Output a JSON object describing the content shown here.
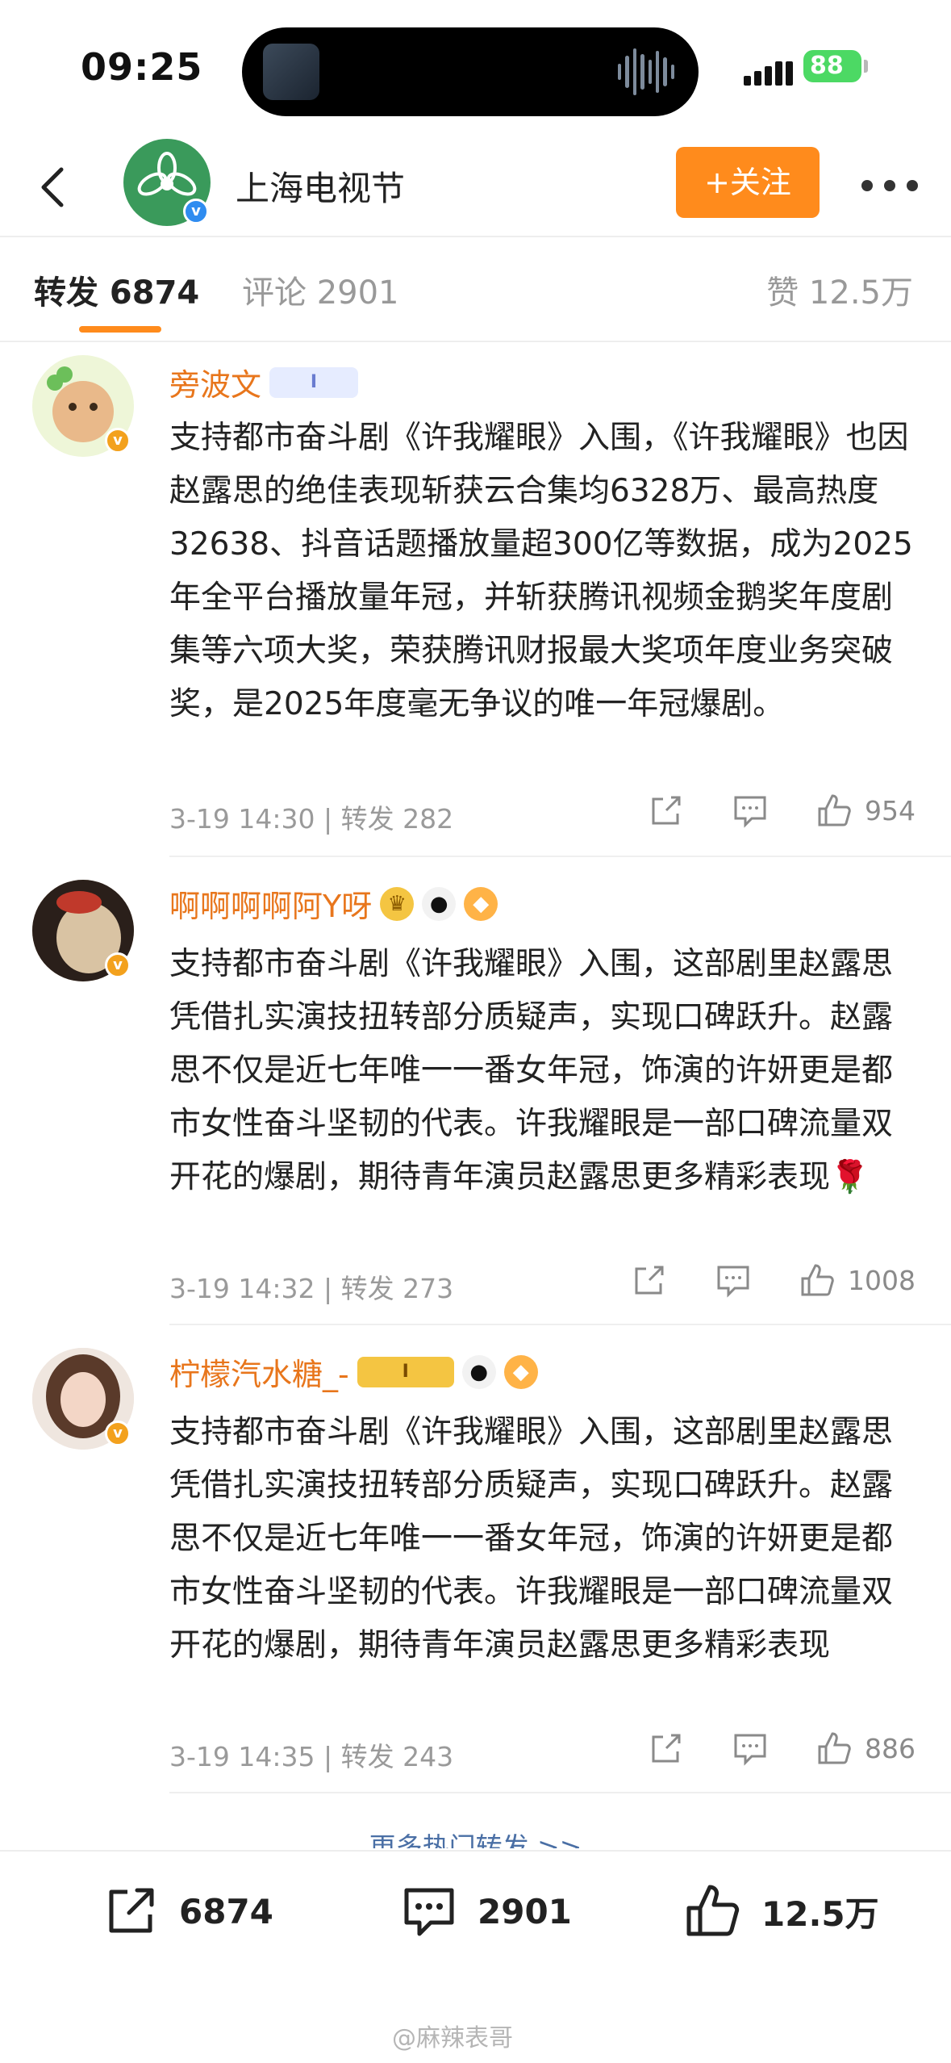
{
  "status_bar": {
    "time": "09:25",
    "battery": "88"
  },
  "header": {
    "account_name": "上海电视节",
    "follow_label": "+关注"
  },
  "tabs": {
    "repost": "转发 6874",
    "comments": "评论 2901",
    "likes": "赞 12.5万"
  },
  "posts": [
    {
      "author": "旁波文",
      "badge": "I",
      "text": "支持都市奋斗剧《许我耀眼》入围，《许我耀眼》也因赵露思的绝佳表现斩获云合集均6328万、最高热度32638、抖音话题播放量超300亿等数据，成为2025年全平台播放量年冠，并斩获腾讯视频金鹅奖年度剧集等六项大奖，荣获腾讯财报最大奖项年度业务突破奖，是2025年度毫无争议的唯一年冠爆剧。",
      "time": "3-19 14:30",
      "repost": "转发 282",
      "likes": "954"
    },
    {
      "author": "啊啊啊啊阿Y呀",
      "text": "支持都市奋斗剧《许我耀眼》入围，这部剧里赵露思凭借扎实演技扭转部分质疑声，实现口碑跃升。赵露思不仅是近七年唯一一番女年冠，饰演的许妍更是都市女性奋斗坚韧的代表。许我耀眼是一部口碑流量双开花的爆剧，期待青年演员赵露思更多精彩表现🌹",
      "time": "3-19 14:32",
      "repost": "转发 273",
      "likes": "1008"
    },
    {
      "author": "柠檬汽水糖_-",
      "badge": "I",
      "text": "支持都市奋斗剧《许我耀眼》入围，这部剧里赵露思凭借扎实演技扭转部分质疑声，实现口碑跃升。赵露思不仅是近七年唯一一番女年冠，饰演的许妍更是都市女性奋斗坚韧的代表。许我耀眼是一部口碑流量双开花的爆剧，期待青年演员赵露思更多精彩表现",
      "time": "3-19 14:35",
      "repost": "转发 243",
      "likes": "886"
    }
  ],
  "more_link": "更多热门转发 >>",
  "bottom_bar": {
    "repost_count": "6874",
    "comment_count": "2901",
    "like_count": "12.5万"
  },
  "watermark": "@麻辣表哥",
  "colors": {
    "accent": "#ff8b1c",
    "author": "#e8761c",
    "verified_blue": "#2f8cf0",
    "verified_gold": "#f3a11d"
  }
}
